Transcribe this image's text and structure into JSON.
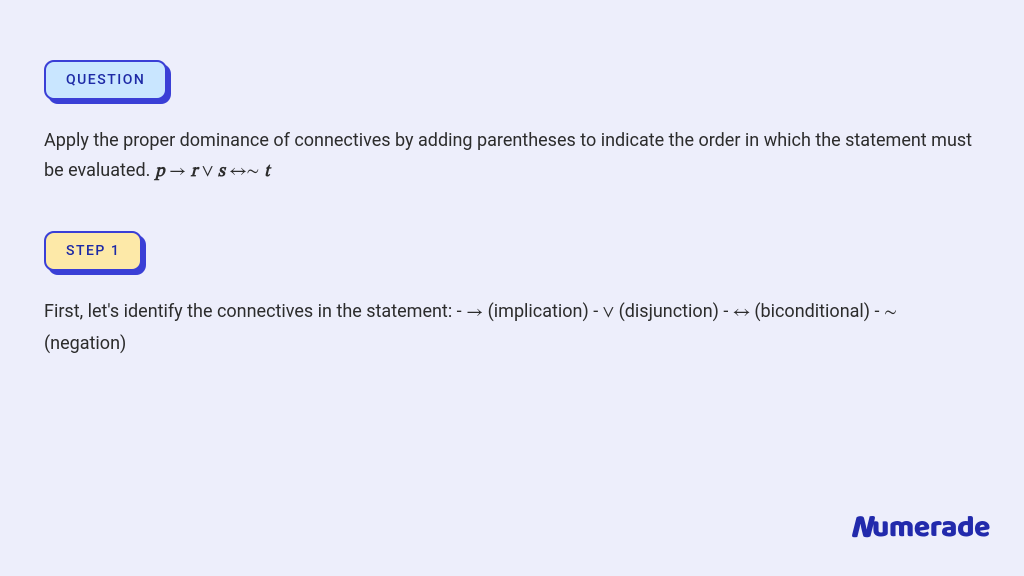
{
  "badges": {
    "question": "QUESTION",
    "step1": "STEP 1"
  },
  "question": {
    "prompt_prefix": "Apply the proper dominance of connectives by adding parentheses to indicate the order in which the statement must be evaluated. ",
    "formula": {
      "p": "p",
      "arrow": "→",
      "r": "r",
      "or": "∨",
      "s": "s",
      "iff": "↔",
      "neg": "∼",
      "t": "t"
    }
  },
  "step1": {
    "text_prefix": "First, let's identify the connectives in the statement: - ",
    "arrow": "→",
    "arrow_label": " (implication) - ",
    "or": "∨",
    "or_label": " (disjunction) - ",
    "iff": "↔",
    "iff_label": " (biconditional) - ",
    "neg": "∼",
    "neg_label": " (negation)"
  },
  "brand": "umerade"
}
